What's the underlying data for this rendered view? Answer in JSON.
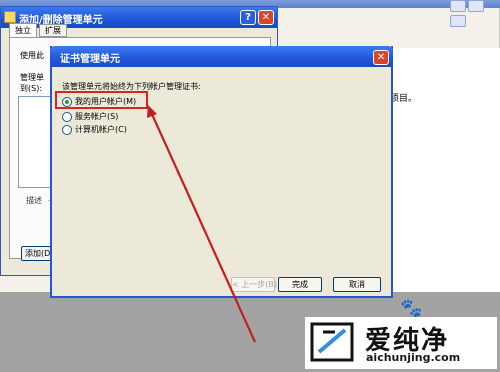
{
  "console": {
    "right_pane_text": "项目。"
  },
  "add_remove_dialog": {
    "title": "添加/删除管理单元",
    "help_label": "?",
    "close_label": "✕",
    "tabs": [
      {
        "label": "独立"
      },
      {
        "label": "扩展"
      }
    ],
    "use_text": "使用此",
    "snapin_label_1": "管理单",
    "snapin_label_2": "到(S):",
    "description_label": "描述",
    "add_button_label": "添加(D)"
  },
  "cert_dialog": {
    "title": "证书管理单元",
    "close_label": "✕",
    "prompt": "该管理单元将始终为下列帐户管理证书:",
    "options": [
      {
        "label": "我的用户帐户(M)",
        "checked": true
      },
      {
        "label": "服务帐户(S)",
        "checked": false
      },
      {
        "label": "计算机帐户(C)",
        "checked": false
      }
    ],
    "back_button": "< 上一步(B)",
    "finish_button": "完成",
    "cancel_button": "取消"
  },
  "annotation": {
    "highlight_color": "#e12121",
    "arrow_color": "#c41e1e"
  },
  "watermark": {
    "name": "爱纯净",
    "url": "aichunjing.com"
  }
}
